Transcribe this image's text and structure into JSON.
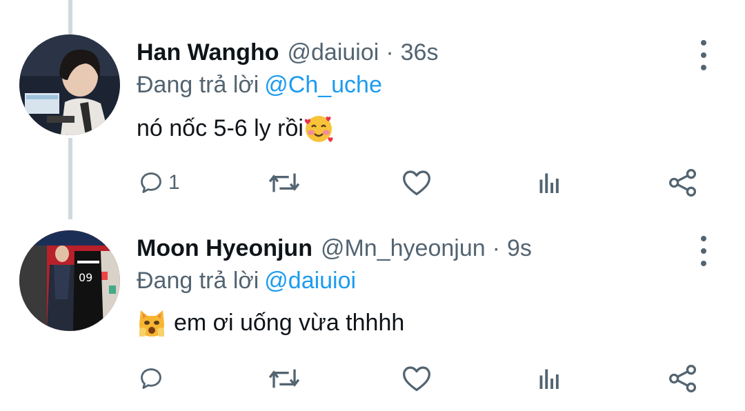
{
  "tweets": [
    {
      "name": "Han Wangho",
      "handle": "@daiuioi",
      "dot": "·",
      "time": "36s",
      "reply_prefix": "Đang trả lời",
      "reply_to": "@Ch_uche",
      "text": "nó nốc 5-6 ly rồi",
      "trailing_emoji": "smiling-face-with-hearts",
      "reply_count": "1"
    },
    {
      "name": "Moon Hyeonjun",
      "handle": "@Mn_hyeonjun",
      "dot": "·",
      "time": "9s",
      "reply_prefix": "Đang trả lời",
      "reply_to": "@daiuioi",
      "leading_emoji": "weary-cat-face",
      "text": "em ơi uống vừa thhhh",
      "reply_count": ""
    }
  ],
  "colors": {
    "name": "#0f1419",
    "secondary": "#536471",
    "mention": "#1d9bf0",
    "thread_line": "#cfd9de"
  }
}
